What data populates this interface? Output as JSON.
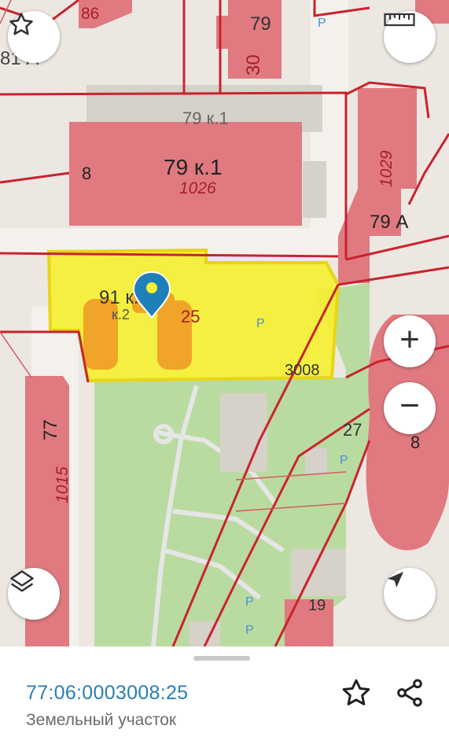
{
  "map": {
    "labels": {
      "house_86": "86",
      "house_79_top": "79",
      "house_30": "30",
      "house_81": "81 А",
      "house_79k1_top": "79 к.1",
      "house_79k1": "79 к.1",
      "num_1026": "1026",
      "num_8_left": "8",
      "num_1029": "1029",
      "house_79a": "79 А",
      "house_91": "91 к.2",
      "num_k2": "к.2",
      "num_25": "25",
      "num_3008": "3008",
      "house_77": "77",
      "num_1015": "1015",
      "num_27": "27",
      "num_8_right": "8",
      "house_19": "19",
      "parking": "P"
    },
    "colors": {
      "building": "#e07a80",
      "parcel_line": "#c9232e",
      "selected_fill": "#f5ef2f",
      "marker": "#1f7fb8",
      "park": "#b9dba0"
    }
  },
  "controls": {
    "favorite_icon": "star-outline-icon",
    "ruler_icon": "ruler-icon",
    "zoom_in": "+",
    "zoom_out": "−",
    "layers_icon": "layers-icon",
    "locate_icon": "navigation-arrow-icon"
  },
  "sheet": {
    "cadastral_number": "77:06:0003008:25",
    "object_type": "Земельный участок"
  }
}
